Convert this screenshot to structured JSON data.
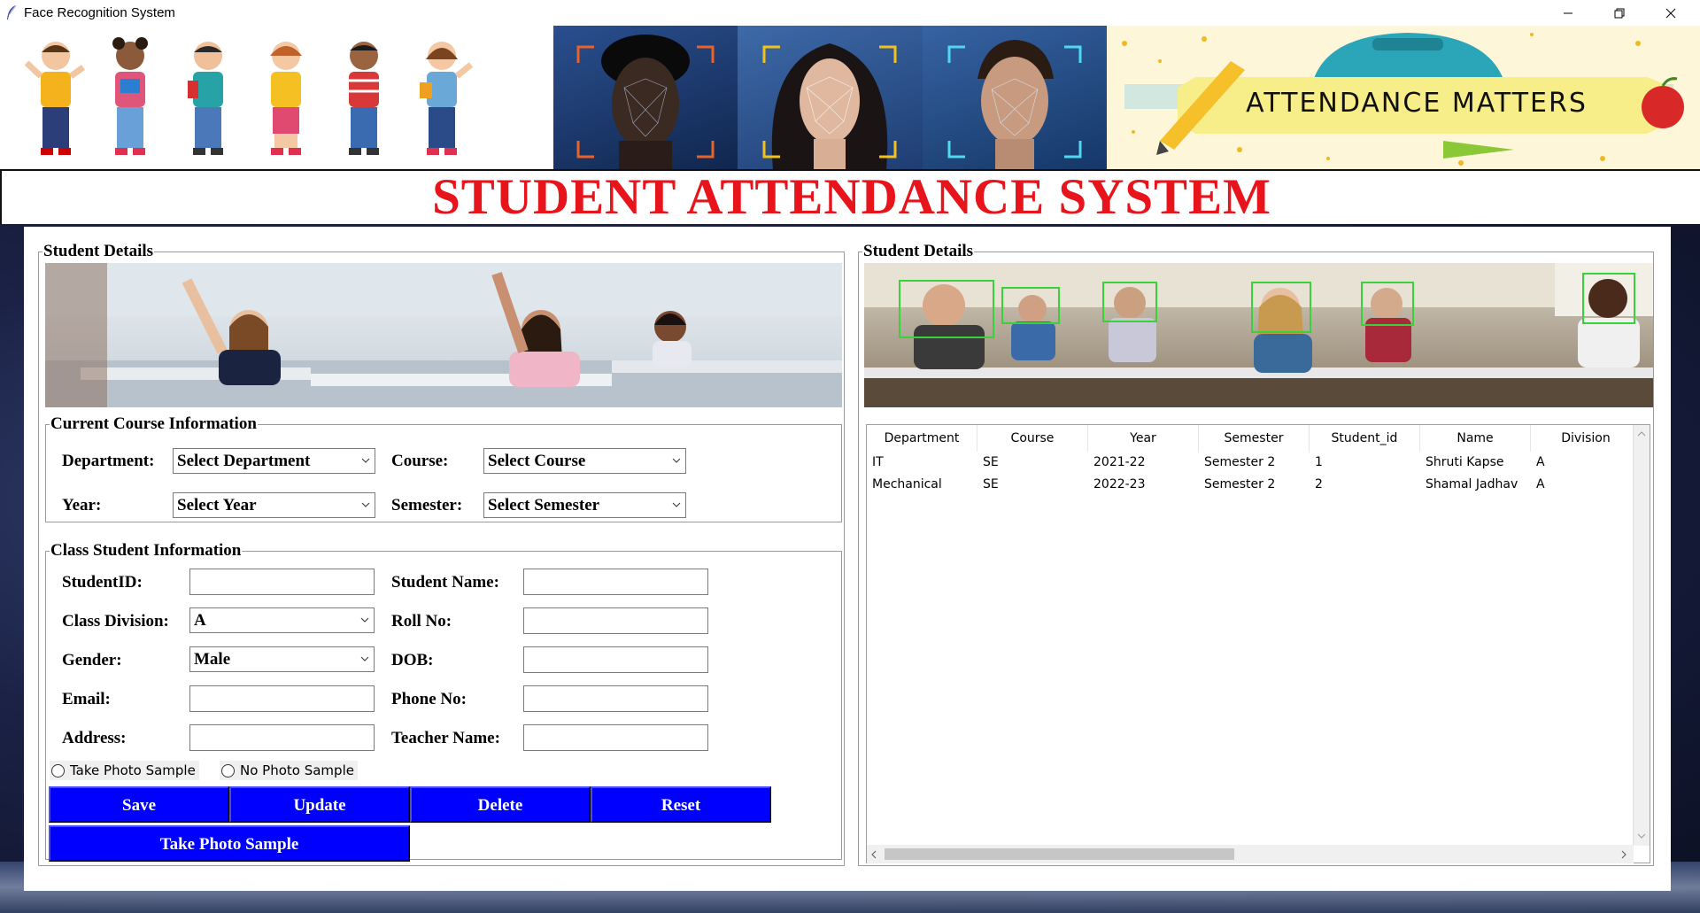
{
  "window": {
    "title": "Face Recognition System",
    "minimize_icon": "minimize-icon",
    "restore_icon": "restore-icon",
    "close_icon": "close-icon"
  },
  "banner": {
    "attendance_text": "ATTENDANCE MATTERS",
    "heading": "STUDENT ATTENDANCE SYSTEM"
  },
  "left_panel": {
    "legend": "Student Details",
    "course_info": {
      "legend": "Current Course Information",
      "department_label": "Department:",
      "department_value": "Select Department",
      "course_label": "Course:",
      "course_value": "Select Course",
      "year_label": "Year:",
      "year_value": "Select Year",
      "semester_label": "Semester:",
      "semester_value": "Select Semester"
    },
    "class_info": {
      "legend": "Class Student Information",
      "student_id_label": "StudentID:",
      "student_name_label": "Student Name:",
      "division_label": "Class Division:",
      "division_value": "A",
      "roll_label": "Roll No:",
      "gender_label": "Gender:",
      "gender_value": "Male",
      "dob_label": "DOB:",
      "email_label": "Email:",
      "phone_label": "Phone No:",
      "address_label": "Address:",
      "teacher_label": "Teacher Name:",
      "radio_take": "Take Photo Sample",
      "radio_no": "No Photo Sample"
    },
    "buttons": {
      "save": "Save",
      "update": "Update",
      "delete": "Delete",
      "reset": "Reset",
      "take_photo": "Take Photo Sample"
    }
  },
  "right_panel": {
    "legend": "Student Details",
    "table": {
      "columns": [
        "Department",
        "Course",
        "Year",
        "Semester",
        "Student_id",
        "Name",
        "Division"
      ],
      "rows": [
        [
          "IT",
          "SE",
          "2021-22",
          "Semester 2",
          "1",
          "Shruti Kapse",
          "A"
        ],
        [
          "Mechanical",
          "SE",
          "2022-23",
          "Semester 2",
          "2",
          "Shamal Jadhav",
          "A"
        ]
      ]
    }
  },
  "colors": {
    "heading_red": "#e8141c",
    "button_blue": "#0000ff"
  }
}
